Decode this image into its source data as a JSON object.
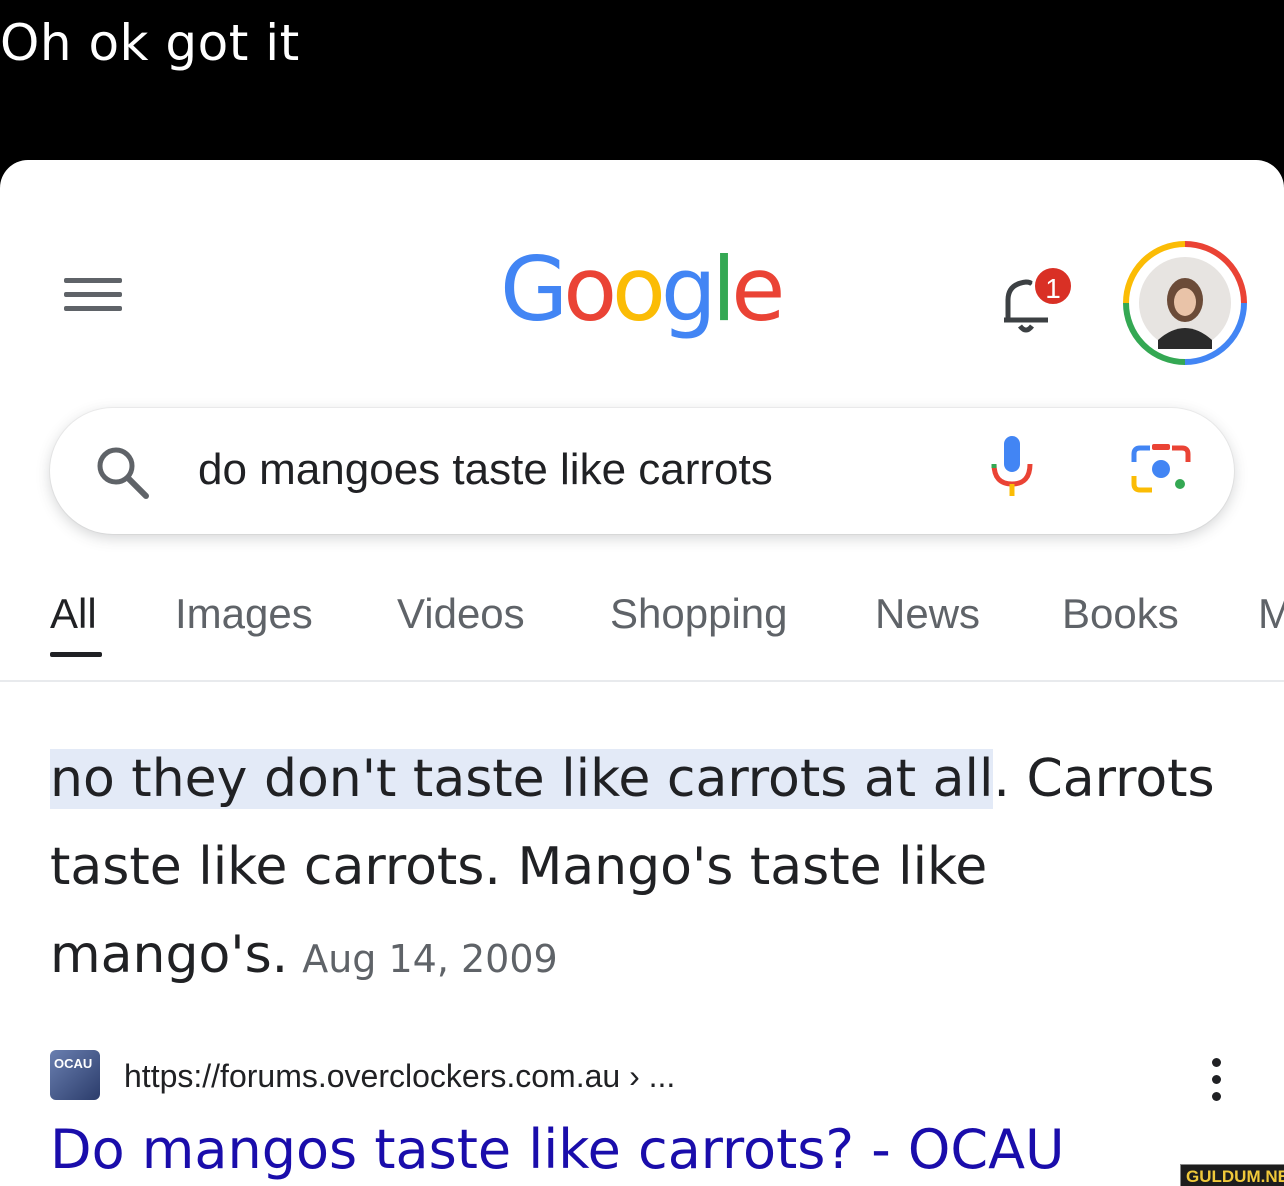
{
  "caption": "Oh ok got it",
  "header": {
    "logo_letters": [
      {
        "char": "G",
        "color": "#4285F4"
      },
      {
        "char": "o",
        "color": "#EA4335"
      },
      {
        "char": "o",
        "color": "#FBBC05"
      },
      {
        "char": "g",
        "color": "#4285F4"
      },
      {
        "char": "l",
        "color": "#34A853"
      },
      {
        "char": "e",
        "color": "#EA4335"
      }
    ],
    "notification_count": "1"
  },
  "search": {
    "query": "do mangoes taste like carrots"
  },
  "tabs": [
    "All",
    "Images",
    "Videos",
    "Shopping",
    "News",
    "Books",
    "M"
  ],
  "snippet": {
    "highlight": "no they don't taste like carrots at all",
    "after_highlight": ". Carrots taste like carrots. Mango's taste like mango's.",
    "date": "Aug 14, 2009"
  },
  "result": {
    "favicon_text": "OCAU",
    "url": "https://forums.overclockers.com.au › ...",
    "title": "Do mangos taste like carrots? - OCAU"
  },
  "watermark": "GULDUM.NET",
  "colors": {
    "link": "#1a0dab",
    "highlight": "#e3eaf7",
    "badge": "#d93025"
  }
}
